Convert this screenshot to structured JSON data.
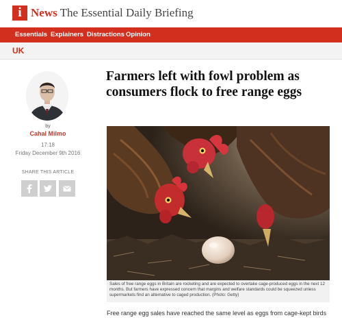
{
  "header": {
    "logo_letter": "i",
    "brand_news": "News",
    "brand_tagline": "The Essential Daily Briefing"
  },
  "nav": {
    "items": [
      {
        "label": "Essentials"
      },
      {
        "label": "Explainers"
      },
      {
        "label": "Distractions"
      },
      {
        "label": "Opinion"
      }
    ]
  },
  "section": {
    "label": "UK"
  },
  "article": {
    "headline": "Farmers left with fowl problem as consumers flock to free range eggs",
    "byline_prefix": "by",
    "author": "Cahal Milmo",
    "time": "17:18",
    "date": "Friday December 9th 2016",
    "share_label": "SHARE THIS ARTICLE",
    "share_icons": [
      "facebook-icon",
      "twitter-icon",
      "email-icon"
    ],
    "caption": "Sales of free range eggs in Britain are rocketing and are expected to overtake cage-produced eggs in the next 12 months. But farmers have expressed concern that margins and welfare standards could be squeezed unless supermarkets find an alternative to caged production. (Photo: Getty)",
    "body_first_line": "Free range egg sales have reached the same level as eggs from cage-kept birds"
  },
  "colors": {
    "brand_red": "#d32f1e",
    "author_link": "#c0392b",
    "share_button_gray": "#cfcfcf"
  }
}
